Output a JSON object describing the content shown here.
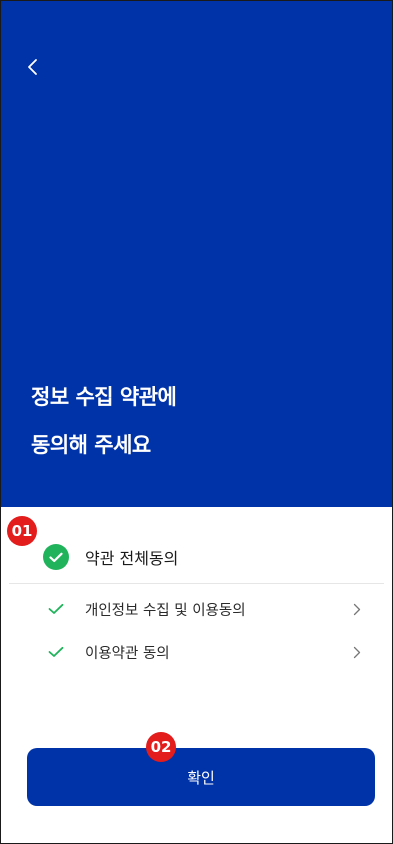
{
  "colors": {
    "primary": "#0033a8",
    "check_green": "#21b35c",
    "badge_red": "#e31c1c",
    "divider": "#e6e6e6",
    "chevron": "#777777"
  },
  "header": {
    "back_icon": "chevron-left-icon",
    "title_line1": "정보 수집 약관에",
    "title_line2": "동의해 주세요"
  },
  "annotations": {
    "badge_1": "01",
    "badge_2": "02"
  },
  "terms": {
    "agree_all_label": "약관 전체동의",
    "agree_all_checked": true,
    "items": [
      {
        "label": "개인정보 수집 및 이용동의",
        "checked": true,
        "icon": "chevron-right-icon"
      },
      {
        "label": "이용약관 동의",
        "checked": true,
        "icon": "chevron-right-icon"
      }
    ]
  },
  "footer": {
    "confirm_label": "확인"
  }
}
